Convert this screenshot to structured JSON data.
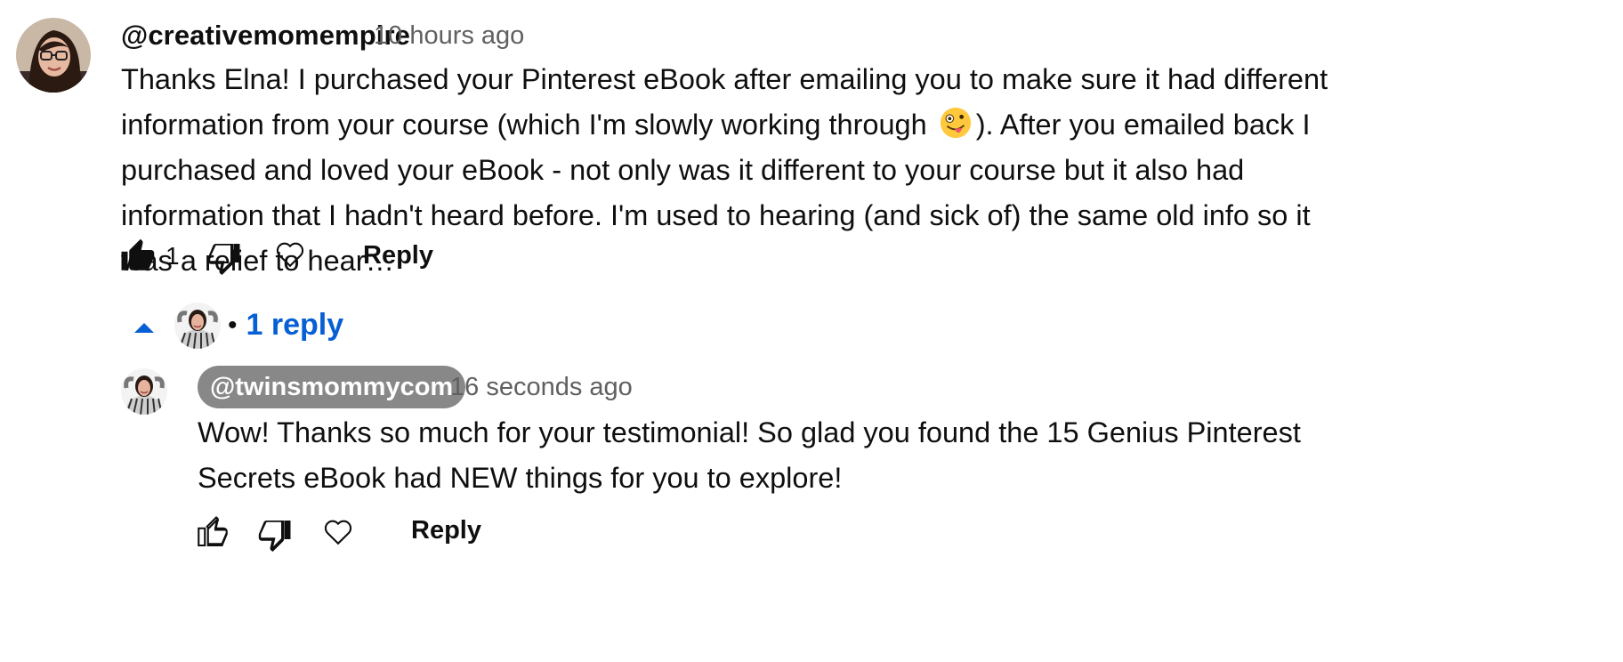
{
  "comment": {
    "author": "@creativemomempire",
    "time": "10 hours ago",
    "text_part1": "Thanks Elna! I purchased your Pinterest eBook after emailing you to make sure it had different information from your course (which I'm slowly working through ",
    "emoji": "zany-face-emoji",
    "text_part2": "). After you emailed back I purchased and loved your eBook - not only was it different to your course but it also had information that I hadn't heard before. I'm used to hearing (and sick of) the same old info so it was a relief to hear…",
    "like_count": "1",
    "reply_label": "Reply",
    "liked": true
  },
  "replies_toggle": {
    "label": "1 reply",
    "separator": "•",
    "expanded": true
  },
  "reply": {
    "author": "@twinsmommycom",
    "time": "16 seconds ago",
    "text": "Wow! Thanks so much for your testimonial! So glad you found the 15 Genius Pinterest Secrets eBook had NEW things for you to explore!",
    "reply_label": "Reply",
    "liked": false
  },
  "colors": {
    "link_blue": "#065fd4",
    "meta_gray": "#606060",
    "pill_gray": "#888888"
  }
}
